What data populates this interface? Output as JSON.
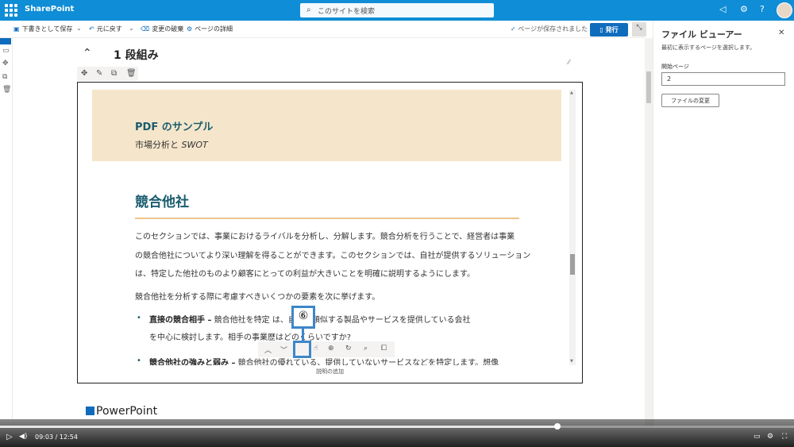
{
  "suitebar": {
    "brand": "SharePoint",
    "search_placeholder": "このサイトを検索"
  },
  "commandbar": {
    "save_draft": "下書きとして保存",
    "undo": "元に戻す",
    "discard": "変更の破棄",
    "page_details": "ページの詳細",
    "saved_status": "ページが保存されました",
    "publish": "発行"
  },
  "canvas": {
    "section_title": "1 段組み",
    "ppt_heading": "PowerPoint"
  },
  "pdf": {
    "title": "PDF のサンプル",
    "subtitle_prefix": "市場分析と",
    "subtitle_em": "SWOT",
    "heading": "競合他社",
    "para1_line1": "このセクションでは、事業におけるライバルを分析し、分解します。競合分析を行うことで、経営者は事業",
    "para1_line2": "の競合他社についてより深い理解を得ることができます。このセクションでは、自社が提供するソリューション",
    "para1_line3": "は、特定した他社のものより顧客にとっての利益が大きいことを明確に説明するようにします。",
    "para2": "競合他社を分析する際に考慮すべきいくつかの要素を次に挙げます。",
    "bullet1_bold": "直接の競合相手 –",
    "bullet1_line1": " 競合他社を特定        は、自社と類似する製品やサービスを提供している会社",
    "bullet1_line2": "を中心に検討します。相手の事業歴はどのくらいですか?",
    "bullet2_bold": "競合他社の強みと弱み –",
    "bullet2_line1": " 競合他社の優れている、提供していないサービスなどを特定します。想像"
  },
  "pdf_toolbar": {
    "caption": "説明の追加"
  },
  "callout": {
    "number": "⑥"
  },
  "panel": {
    "title": "ファイル ビューアー",
    "description": "最初に表示するページを選択します。",
    "start_page_label": "開始ページ",
    "start_page_value": "2",
    "change_file": "ファイルの変更"
  },
  "video": {
    "current": "09:03",
    "separator": "/",
    "total": "12:54",
    "progress": 0.701
  }
}
